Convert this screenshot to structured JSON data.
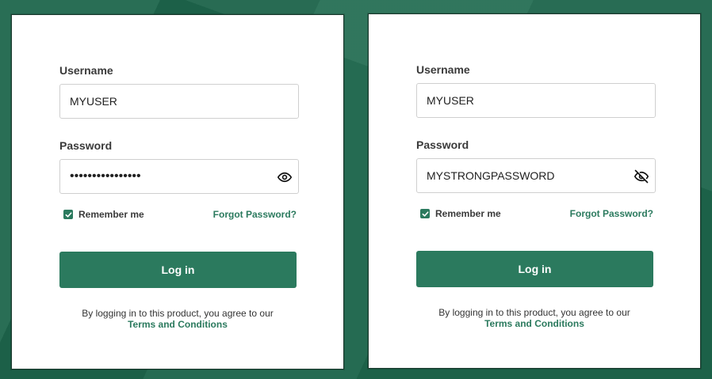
{
  "colors": {
    "accent": "#2b7a5e",
    "background": "#1f6a4f",
    "panel": "#ffffff"
  },
  "panels": [
    {
      "username_label": "Username",
      "username_value": "MYUSER",
      "password_label": "Password",
      "password_value": "••••••••••••••••",
      "password_masked": true,
      "visibility_icon": "eye-icon",
      "remember_label": "Remember me",
      "remember_checked": true,
      "forgot_label": "Forgot Password?",
      "login_label": "Log in",
      "terms_text": "By logging in to this product, you agree to our",
      "terms_link": "Terms and Conditions"
    },
    {
      "username_label": "Username",
      "username_value": "MYUSER",
      "password_label": "Password",
      "password_value": "MYSTRONGPASSWORD",
      "password_masked": false,
      "visibility_icon": "eye-slash-icon",
      "remember_label": "Remember me",
      "remember_checked": true,
      "forgot_label": "Forgot Password?",
      "login_label": "Log in",
      "terms_text": "By logging in to this product, you agree to our",
      "terms_link": "Terms and Conditions"
    }
  ]
}
